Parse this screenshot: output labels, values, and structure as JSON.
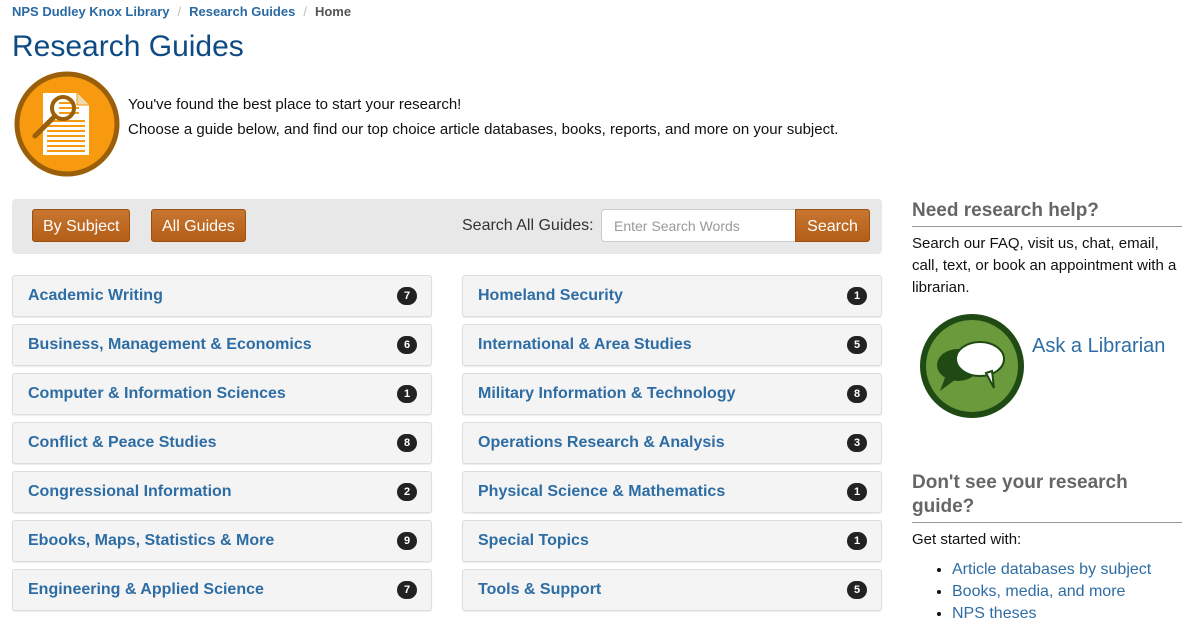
{
  "breadcrumb": {
    "items": [
      {
        "label": "NPS Dudley Knox Library"
      },
      {
        "label": "Research Guides"
      }
    ],
    "current": "Home",
    "separator": "/"
  },
  "header": {
    "title": "Research Guides",
    "icon": "document-magnifier-icon",
    "intro_line1": "You've found the best place to start your research!",
    "intro_line2": "Choose a guide below, and find our top choice article databases, books, reports, and more on your subject."
  },
  "toolbar": {
    "by_subject_label": "By Subject",
    "all_guides_label": "All Guides",
    "search_label": "Search All Guides:",
    "search_placeholder": "Enter Search Words",
    "search_value": "",
    "search_button_label": "Search"
  },
  "colors": {
    "accent_orange": "#b45e17",
    "link_blue": "#2e6da4",
    "title_blue": "#0e4a83",
    "badge_dark": "#222222",
    "icon_orange": "#f89a0f",
    "icon_green": "#6a9a3c"
  },
  "guides_left": [
    {
      "name": "Academic Writing",
      "count": "7"
    },
    {
      "name": "Business, Management & Economics",
      "count": "6"
    },
    {
      "name": "Computer & Information Sciences",
      "count": "1"
    },
    {
      "name": "Conflict & Peace Studies",
      "count": "8"
    },
    {
      "name": "Congressional Information",
      "count": "2"
    },
    {
      "name": "Ebooks, Maps, Statistics & More",
      "count": "9"
    },
    {
      "name": "Engineering & Applied Science",
      "count": "7"
    }
  ],
  "guides_right": [
    {
      "name": "Homeland Security",
      "count": "1"
    },
    {
      "name": "International & Area Studies",
      "count": "5"
    },
    {
      "name": "Military Information & Technology",
      "count": "8"
    },
    {
      "name": "Operations Research & Analysis",
      "count": "3"
    },
    {
      "name": "Physical Science & Mathematics",
      "count": "1"
    },
    {
      "name": "Special Topics",
      "count": "1"
    },
    {
      "name": "Tools & Support",
      "count": "5"
    }
  ],
  "sidebar": {
    "help_heading": "Need research help?",
    "help_text": "Search our FAQ, visit us, chat, email, call, text, or book an appointment with a librarian.",
    "ask_icon": "chat-bubbles-icon",
    "ask_label": "Ask a Librarian",
    "missing_heading": "Don't see your research guide?",
    "missing_text": "Get started with:",
    "links": [
      {
        "label": "Article databases by subject"
      },
      {
        "label": "Books, media, and more"
      },
      {
        "label": "NPS theses"
      }
    ]
  }
}
